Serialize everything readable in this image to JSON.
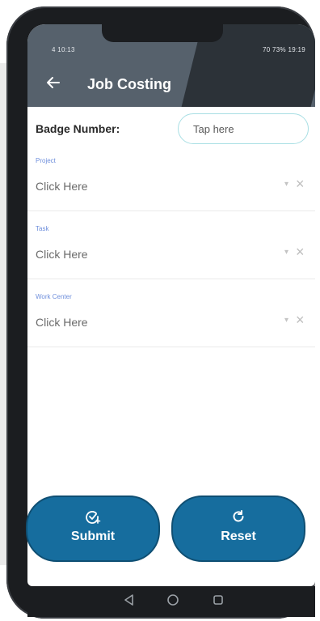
{
  "status_bar": {
    "left": "4 10:13",
    "right": "70 73% 19:19"
  },
  "app_bar": {
    "title": "Job Costing"
  },
  "badge": {
    "label": "Badge Number:",
    "placeholder": "Tap here"
  },
  "fields": [
    {
      "label": "Project",
      "value": "Click Here"
    },
    {
      "label": "Task",
      "value": "Click Here"
    },
    {
      "label": "Work Center",
      "value": "Click Here"
    }
  ],
  "buttons": {
    "submit_label": "Submit",
    "reset_label": "Reset"
  },
  "colors": {
    "app_bar": "#56616c",
    "button": "#166d9e",
    "label_blue": "#6f8fdc",
    "input_border": "#a9dfe4"
  },
  "icons": {
    "back": "arrow-left-icon",
    "dropdown": "chevron-down-icon",
    "clear": "close-icon",
    "submit": "check-circle-plus-icon",
    "reset": "refresh-icon",
    "nav": [
      "nav-back-icon",
      "nav-home-icon",
      "nav-recent-icon"
    ]
  }
}
